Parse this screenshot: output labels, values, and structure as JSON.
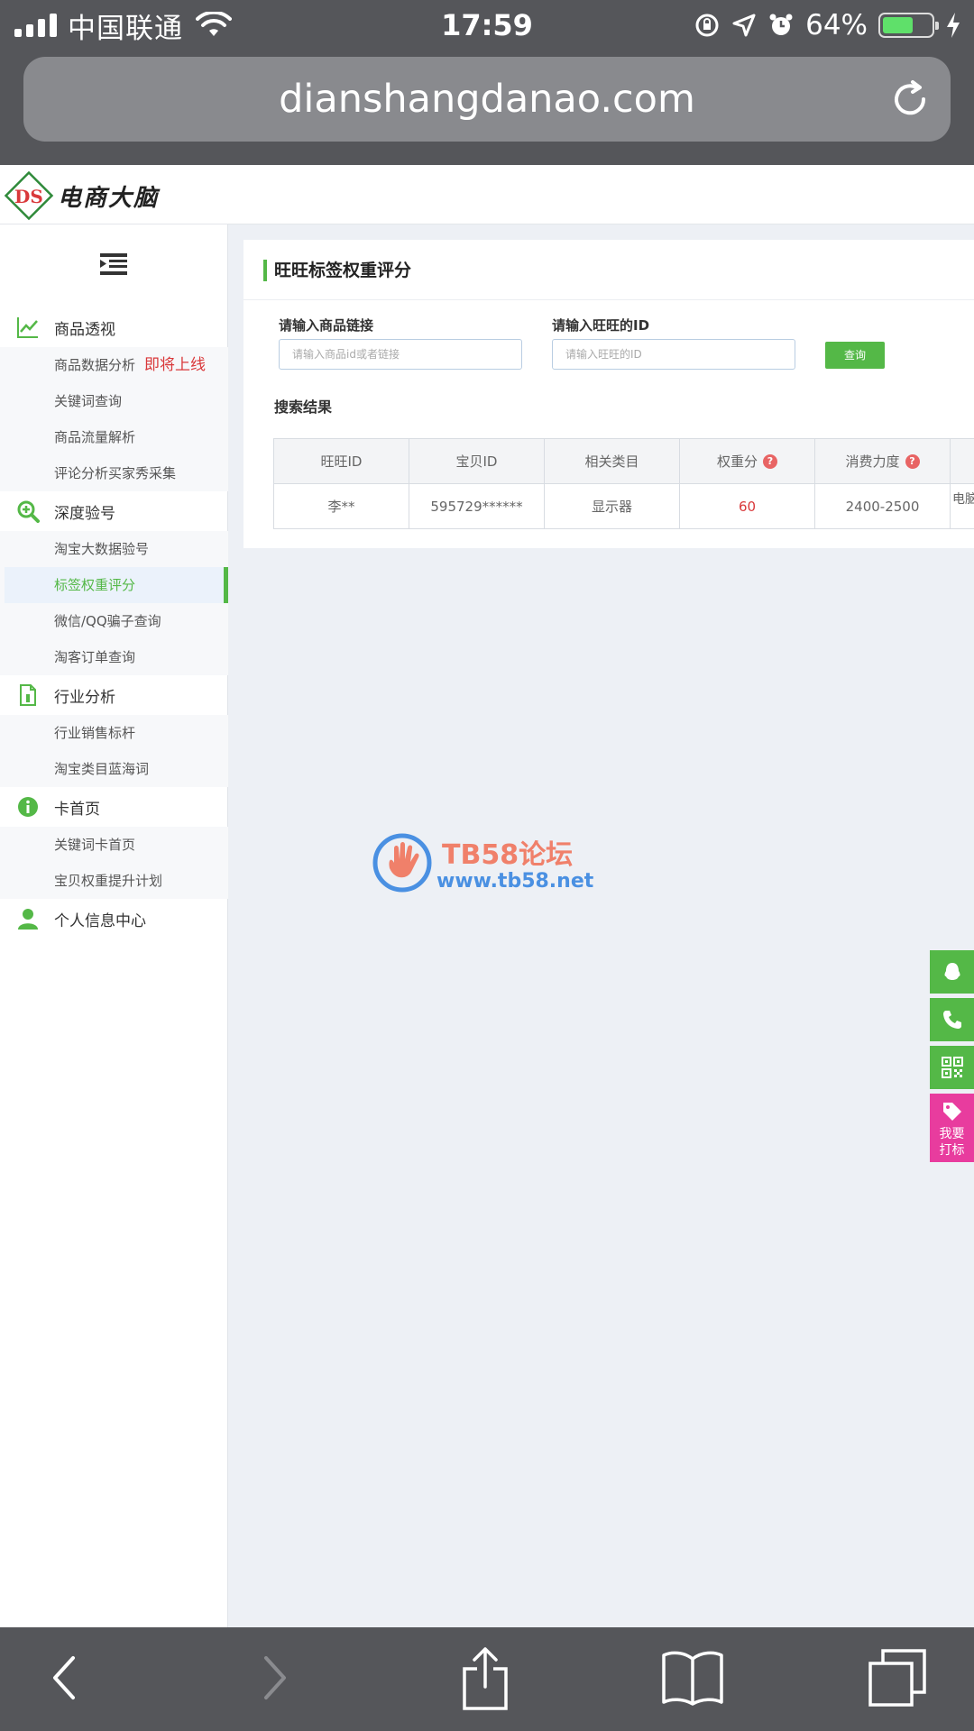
{
  "status_bar": {
    "carrier": "中国联通",
    "time": "17:59",
    "battery_percent": "64%",
    "battery_level": 0.64
  },
  "browser": {
    "url": "dianshangdanao.com"
  },
  "site": {
    "logo_text": "电商大脑"
  },
  "sidebar": {
    "groups": [
      {
        "label": "商品透视",
        "icon": "line-chart-icon",
        "items": [
          {
            "label": "商品数据分析",
            "badge": "即将上线"
          },
          {
            "label": "关键词查询"
          },
          {
            "label": "商品流量解析"
          },
          {
            "label": "评论分析买家秀采集"
          }
        ]
      },
      {
        "label": "深度验号",
        "icon": "search-plus-icon",
        "items": [
          {
            "label": "淘宝大数据验号"
          },
          {
            "label": "标签权重评分",
            "active": true
          },
          {
            "label": "微信/QQ骗子查询"
          },
          {
            "label": "淘客订单查询"
          }
        ]
      },
      {
        "label": "行业分析",
        "icon": "document-icon",
        "items": [
          {
            "label": "行业销售标杆"
          },
          {
            "label": "淘宝类目蓝海词"
          }
        ]
      },
      {
        "label": "卡首页",
        "icon": "info-icon",
        "items": [
          {
            "label": "关键词卡首页"
          },
          {
            "label": "宝贝权重提升计划"
          }
        ]
      },
      {
        "label": "个人信息中心",
        "icon": "user-icon",
        "items": []
      }
    ]
  },
  "main": {
    "title": "旺旺标签权重评分",
    "product_link_label": "请输入商品链接",
    "product_link_placeholder": "请输入商品id或者链接",
    "wangwang_label": "请输入旺旺的ID",
    "wangwang_placeholder": "请输入旺旺的ID",
    "query_button": "查询",
    "results_title": "搜索结果",
    "table": {
      "headers": [
        "旺旺ID",
        "宝贝ID",
        "相关类目",
        "权重分",
        "消费力度",
        ""
      ],
      "rows": [
        [
          "李**",
          "595729******",
          "显示器",
          "60",
          "2400-2500",
          "电脑"
        ]
      ]
    }
  },
  "watermark": {
    "title": "TB58论坛",
    "url": "www.tb58.net"
  },
  "float_buttons": {
    "mark_label_1": "我要",
    "mark_label_2": "打标"
  },
  "colors": {
    "accent": "#54b847",
    "badge_red": "#d9383a",
    "chrome": "#55565a",
    "mark_pink": "#e83c9e"
  }
}
